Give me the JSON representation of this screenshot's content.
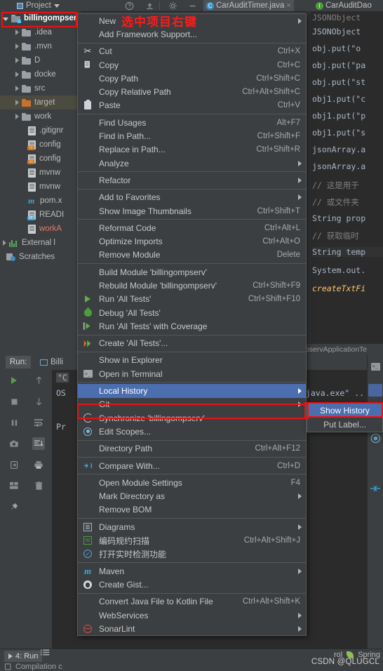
{
  "toolbar": {
    "project_label": "Project",
    "icons": [
      "help-icon",
      "upload-icon",
      "settings-gear-icon",
      "minimize-icon"
    ]
  },
  "editor_tabs": [
    {
      "label": "CarAuditTimer.java",
      "icon": "class-c-icon",
      "icon_letter": "C",
      "icon_color": "#3b94c9",
      "active": true,
      "closable": true
    },
    {
      "label": "CarAuditDao",
      "icon": "interface-i-icon",
      "icon_letter": "I",
      "icon_color": "#4f9c3f",
      "active": false,
      "closable": false
    }
  ],
  "project_tree": {
    "items": [
      {
        "label": "billingompserv",
        "indent": 0,
        "kind": "module-folder",
        "state": "expanded",
        "selected": true,
        "annotated": true
      },
      {
        "label": ".idea",
        "indent": 1,
        "kind": "folder",
        "state": "collapsed"
      },
      {
        "label": ".mvn",
        "indent": 1,
        "kind": "folder",
        "state": "collapsed"
      },
      {
        "label": "D",
        "indent": 1,
        "kind": "folder",
        "state": "collapsed"
      },
      {
        "label": "docke",
        "indent": 1,
        "kind": "folder",
        "state": "collapsed"
      },
      {
        "label": "src",
        "indent": 1,
        "kind": "folder",
        "state": "collapsed"
      },
      {
        "label": "target",
        "indent": 1,
        "kind": "folder-orange",
        "state": "collapsed",
        "highlight": true
      },
      {
        "label": "work",
        "indent": 1,
        "kind": "folder",
        "state": "collapsed"
      },
      {
        "label": ".gitignr",
        "indent": 1,
        "kind": "file"
      },
      {
        "label": "config",
        "indent": 1,
        "kind": "file-xml",
        "badge": "<>"
      },
      {
        "label": "config",
        "indent": 1,
        "kind": "file-xml",
        "badge": "<>"
      },
      {
        "label": "mvnw",
        "indent": 1,
        "kind": "file"
      },
      {
        "label": "mvnw",
        "indent": 1,
        "kind": "file"
      },
      {
        "label": "pom.x",
        "indent": 1,
        "kind": "maven"
      },
      {
        "label": "READI",
        "indent": 1,
        "kind": "file-md",
        "badge": "MD"
      },
      {
        "label": "workA",
        "indent": 1,
        "kind": "file",
        "color": "red"
      },
      {
        "label": "External l",
        "indent": 0,
        "kind": "library",
        "state": "collapsed"
      },
      {
        "label": "Scratches",
        "indent": 0,
        "kind": "scratches"
      }
    ]
  },
  "context_menu": {
    "annotation_text": "选中项目右键",
    "items": [
      {
        "label": "New",
        "submenu": true,
        "icon": null,
        "mnemonic": "N",
        "annotation": "选中项目右键"
      },
      {
        "label": "Add Framework Support...",
        "icon": null
      },
      {
        "separator": true
      },
      {
        "label": "Cut",
        "accel": "Ctrl+X",
        "icon": "scissors-icon",
        "mnemonic": "t"
      },
      {
        "label": "Copy",
        "accel": "Ctrl+C",
        "icon": "copy-icon",
        "mnemonic": "C"
      },
      {
        "label": "Copy Path",
        "accel": "Ctrl+Shift+C",
        "icon": null,
        "mnemonic": "o"
      },
      {
        "label": "Copy Relative Path",
        "accel": "Ctrl+Alt+Shift+C",
        "icon": null,
        "mnemonic": "y"
      },
      {
        "label": "Paste",
        "accel": "Ctrl+V",
        "icon": "paste-icon",
        "mnemonic": "P"
      },
      {
        "separator": true
      },
      {
        "label": "Find Usages",
        "accel": "Alt+F7",
        "icon": null,
        "mnemonic": "U"
      },
      {
        "label": "Find in Path...",
        "accel": "Ctrl+Shift+F",
        "icon": null,
        "mnemonic": "P"
      },
      {
        "label": "Replace in Path...",
        "accel": "Ctrl+Shift+R",
        "icon": null,
        "mnemonic": "c"
      },
      {
        "label": "Analyze",
        "submenu": true,
        "icon": null,
        "mnemonic": "z"
      },
      {
        "separator": true
      },
      {
        "label": "Refactor",
        "submenu": true,
        "icon": null,
        "mnemonic": "R"
      },
      {
        "separator": true
      },
      {
        "label": "Add to Favorites",
        "submenu": true,
        "icon": null,
        "mnemonic": "v"
      },
      {
        "label": "Show Image Thumbnails",
        "accel": "Ctrl+Shift+T",
        "icon": null
      },
      {
        "separator": true
      },
      {
        "label": "Reformat Code",
        "accel": "Ctrl+Alt+L",
        "icon": null,
        "mnemonic": "R"
      },
      {
        "label": "Optimize Imports",
        "accel": "Ctrl+Alt+O",
        "icon": null,
        "mnemonic": "z"
      },
      {
        "label": "Remove Module",
        "accel": "Delete",
        "icon": null
      },
      {
        "separator": true
      },
      {
        "label": "Build Module 'billingompserv'",
        "icon": null,
        "mnemonic": "M"
      },
      {
        "label": "Rebuild Module 'billingompserv'",
        "accel": "Ctrl+Shift+F9",
        "icon": null,
        "mnemonic": "e"
      },
      {
        "label": "Run 'All Tests'",
        "accel": "Ctrl+Shift+F10",
        "icon": "run-green-triangle-icon",
        "mnemonic": "u"
      },
      {
        "label": "Debug 'All Tests'",
        "icon": "debug-bug-icon",
        "mnemonic": "D"
      },
      {
        "label": "Run 'All Tests' with Coverage",
        "icon": "coverage-icon",
        "mnemonic": "v"
      },
      {
        "separator": true
      },
      {
        "label": "Create 'All Tests'...",
        "icon": "create-run-config-icon",
        "mnemonic": "C"
      },
      {
        "separator": true
      },
      {
        "label": "Show in Explorer",
        "icon": null
      },
      {
        "label": "Open in Terminal",
        "icon": "terminal-icon",
        "mnemonic": "O"
      },
      {
        "separator": true
      },
      {
        "label": "Local History",
        "submenu": true,
        "icon": null,
        "highlighted": true,
        "annotated": true,
        "mnemonic": "H"
      },
      {
        "label": "Git",
        "submenu": true,
        "icon": null,
        "mnemonic": "G"
      },
      {
        "label": "Synchronize 'billingompserv'",
        "icon": "sync-icon",
        "mnemonic": "S"
      },
      {
        "label": "Edit Scopes...",
        "icon": "scope-icon",
        "mnemonic": "i"
      },
      {
        "separator": true
      },
      {
        "label": "Directory Path",
        "accel": "Ctrl+Alt+F12",
        "icon": null,
        "mnemonic": "P"
      },
      {
        "separator": true
      },
      {
        "label": "Compare With...",
        "accel": "Ctrl+D",
        "icon": "compare-icon"
      },
      {
        "separator": true
      },
      {
        "label": "Open Module Settings",
        "accel": "F4",
        "icon": null
      },
      {
        "label": "Mark Directory as",
        "submenu": true,
        "icon": null
      },
      {
        "label": "Remove BOM",
        "icon": null
      },
      {
        "separator": true
      },
      {
        "label": "Diagrams",
        "submenu": true,
        "icon": "diagram-icon"
      },
      {
        "label": "编码规约扫描",
        "accel": "Ctrl+Alt+Shift+J",
        "icon": "scan-icon"
      },
      {
        "label": "打开实时检测功能",
        "icon": "realtime-detect-icon"
      },
      {
        "separator": true
      },
      {
        "label": "Maven",
        "submenu": true,
        "icon": "maven-m-icon"
      },
      {
        "label": "Create Gist...",
        "icon": "github-icon"
      },
      {
        "separator": true
      },
      {
        "label": "Convert Java File to Kotlin File",
        "accel": "Ctrl+Alt+Shift+K",
        "icon": null
      },
      {
        "label": "WebServices",
        "submenu": true,
        "icon": null
      },
      {
        "label": "SonarLint",
        "submenu": true,
        "icon": "sonarlint-icon"
      }
    ]
  },
  "submenu": {
    "items": [
      {
        "label": "Show History",
        "highlighted": true,
        "annotated": true,
        "mnemonic": "H"
      },
      {
        "label": "Put Label...",
        "highlighted": false,
        "mnemonic": "L"
      }
    ]
  },
  "code_lines": [
    {
      "text": "JSONObject",
      "type": "plain"
    },
    {
      "text": "obj.put(\"o",
      "type": "plain"
    },
    {
      "text": "obj.put(\"pa",
      "type": "plain"
    },
    {
      "text": "obj.put(\"st",
      "type": "plain"
    },
    {
      "text": "obj1.put(\"c",
      "type": "plain"
    },
    {
      "text": "obj1.put(\"p",
      "type": "plain"
    },
    {
      "text": "obj1.put(\"s",
      "type": "plain"
    },
    {
      "text": "jsonArray.a",
      "type": "plain"
    },
    {
      "text": "jsonArray.a",
      "type": "plain"
    },
    {
      "text": "// 这是用于",
      "type": "comment"
    },
    {
      "text": "// 或文件夹",
      "type": "comment"
    },
    {
      "text": "String prop",
      "type": "keyword"
    },
    {
      "text": "// 获取临时",
      "type": "comment"
    },
    {
      "text": "String temp",
      "type": "keyword"
    },
    {
      "text": "System.out.",
      "type": "field"
    },
    {
      "text": "createTxtFi",
      "type": "method"
    }
  ],
  "breadcrumb": "pservApplicationTe",
  "run_panel": {
    "tab_label": "Run:",
    "config_label": "Billi",
    "console_lines": [
      "\"C",
      "OS",
      "Pr",
      ",java.exe\" .."
    ],
    "left_buttons": [
      "run-icon",
      "stop-icon",
      "pause-icon",
      "camera-icon",
      "export-icon",
      "layout-icon",
      "pin-icon"
    ],
    "mid_buttons": [
      "up-arrow-icon",
      "down-arrow-icon",
      "soft-wrap-icon",
      "scroll-to-end-icon",
      "print-icon",
      "trash-icon"
    ]
  },
  "right_strip_icons": [
    "terminal-icon",
    "highlight-box-icon",
    "sync-icon",
    "record-icon",
    "collapse-icon"
  ],
  "status_bar": {
    "run_tab": "4: Run",
    "message": "Compilation c",
    "right_items": [
      "rol",
      "Spring"
    ],
    "watermark": "CSDN @QLUGCL"
  },
  "colors": {
    "bg": "#3c3f41",
    "editor_bg": "#2b2b2b",
    "menu_bg": "#3c3f41",
    "highlight": "#4b6eaf",
    "annotation_red": "#ee1111",
    "chinese_red": "#ff1a1a",
    "tree_selected": "#4b4b3f"
  }
}
